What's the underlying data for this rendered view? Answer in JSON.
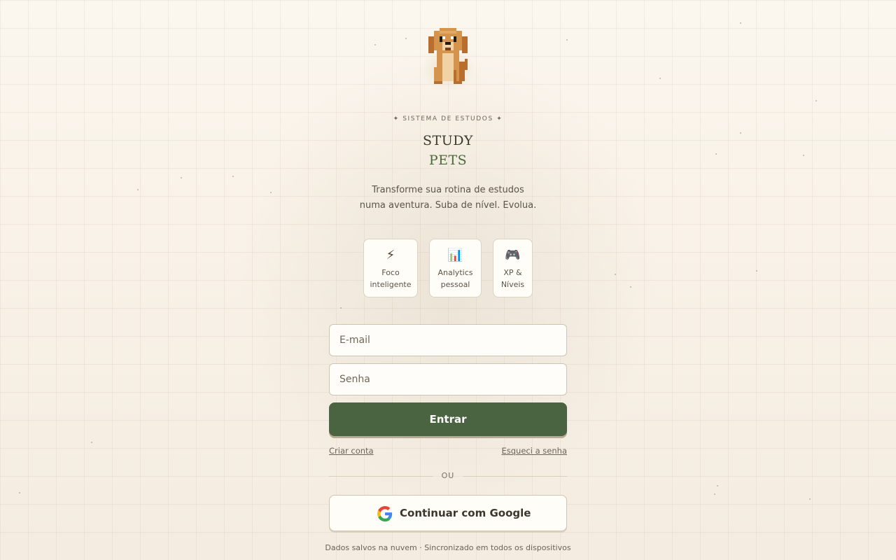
{
  "brand": {
    "eyebrow": "✦ SISTEMA DE ESTUDOS ✦",
    "title_line1": "STUDY",
    "title_line2": "PETS",
    "tagline_line1": "Transforme sua rotina de estudos",
    "tagline_line2": "numa aventura. Suba de nível. Evolua.",
    "logo_icon": "pixel-dog-icon"
  },
  "features": [
    {
      "icon": "⚡",
      "icon_name": "lightning-icon",
      "line1": "Foco",
      "line2": "inteligente"
    },
    {
      "icon": "📊",
      "icon_name": "bar-chart-icon",
      "line1": "Analytics",
      "line2": "pessoal"
    },
    {
      "icon": "🎮",
      "icon_name": "gamepad-icon",
      "line1": "XP &",
      "line2": "Níveis"
    }
  ],
  "form": {
    "email_placeholder": "E-mail",
    "email_value": "",
    "password_placeholder": "Senha",
    "password_value": "",
    "submit_label": "Entrar",
    "create_account": "Criar conta",
    "forgot_password": "Esqueci a senha",
    "divider": "OU",
    "google_label": "Continuar com Google",
    "google_icon": "google-g-icon"
  },
  "footer": "Dados salvos na nuvem · Sincronizado em todos os dispositivos",
  "colors": {
    "primary": "#4a6441",
    "background": "#f5eee3",
    "accent_green_text": "#4a6a3a"
  }
}
